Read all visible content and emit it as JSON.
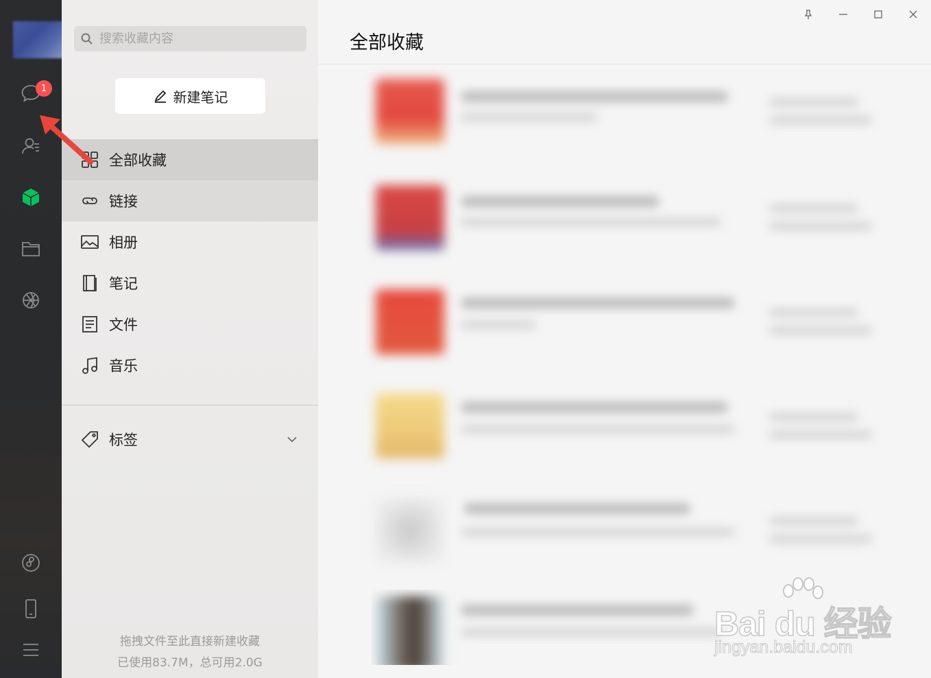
{
  "search": {
    "placeholder": "搜索收藏内容"
  },
  "nav": {
    "new_note_label": "新建笔记",
    "items": [
      {
        "label": "全部收藏",
        "icon": "grid-icon"
      },
      {
        "label": "链接",
        "icon": "link-icon"
      },
      {
        "label": "相册",
        "icon": "image-icon"
      },
      {
        "label": "笔记",
        "icon": "notebook-icon"
      },
      {
        "label": "文件",
        "icon": "file-icon"
      },
      {
        "label": "音乐",
        "icon": "music-icon"
      }
    ],
    "tags_label": "标签",
    "footer_line1": "拖拽文件至此直接新建收藏",
    "footer_line2": "已使用83.7M，总可用2.0G"
  },
  "sidebar": {
    "chat_badge": "1",
    "icons": [
      "chat-icon",
      "contacts-icon",
      "favorites-cube-icon",
      "folder-icon",
      "moments-icon",
      "mini-program-icon",
      "phone-icon",
      "menu-icon"
    ]
  },
  "main": {
    "title": "全部收藏"
  },
  "watermark": {
    "logo": "Bai du 经验",
    "url": "jingyan.baidu.com"
  },
  "colors": {
    "accent": "#07c160",
    "badge": "#fa5151",
    "arrow": "#e8453c"
  }
}
